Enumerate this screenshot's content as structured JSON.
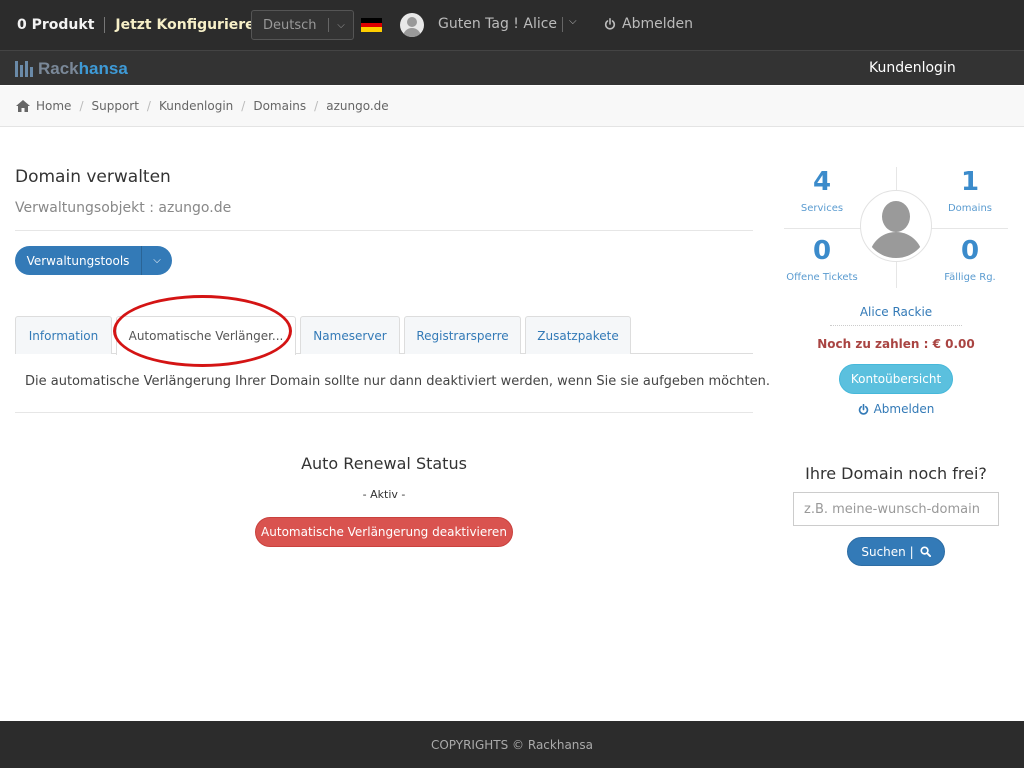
{
  "topbar": {
    "cart": "0 Produkt",
    "configure": "Jetzt Konfigurieren",
    "language": "Deutsch",
    "greeting": "Guten Tag ! Alice",
    "logout": "Abmelden"
  },
  "navbar": {
    "logo_part1": "Rack",
    "logo_part2": "hansa",
    "login": "Kundenlogin"
  },
  "breadcrumb": [
    "Home",
    "Support",
    "Kundenlogin",
    "Domains",
    "azungo.de"
  ],
  "main": {
    "title": "Domain verwalten",
    "subtitle": "Verwaltungsobjekt : azungo.de",
    "tools_button": "Verwaltungstools",
    "tabs": [
      "Information",
      "Automatische Verlänger...",
      "Nameserver",
      "Registrarsperre",
      "Zusatzpakete"
    ],
    "description": "Die automatische Verlängerung Ihrer Domain sollte nur dann deaktiviert werden, wenn Sie sie aufgeben möchten.",
    "renewal_title": "Auto Renewal Status",
    "renewal_status": "- Aktiv -",
    "deactivate_button": "Automatische Verlängerung deaktivieren"
  },
  "sidebar": {
    "stats": [
      {
        "value": "4",
        "label": "Services"
      },
      {
        "value": "1",
        "label": "Domains"
      },
      {
        "value": "0",
        "label": "Offene Tickets"
      },
      {
        "value": "0",
        "label": "Fällige Rg."
      }
    ],
    "user_name": "Alice Rackie",
    "amount_due": "Noch zu zahlen : € 0.00",
    "overview_button": "Kontoübersicht",
    "logout": "Abmelden",
    "domain_question": "Ihre Domain noch frei?",
    "domain_placeholder": "z.B. meine-wunsch-domain",
    "search_button": "Suchen  |"
  },
  "footer": {
    "copyright": "COPYRIGHTS © Rackhansa"
  },
  "colors": {
    "primary": "#337ab7",
    "info": "#5bc0de",
    "danger": "#d9534f",
    "topbar": "#2c2c2c",
    "annotation": "#d41414"
  }
}
